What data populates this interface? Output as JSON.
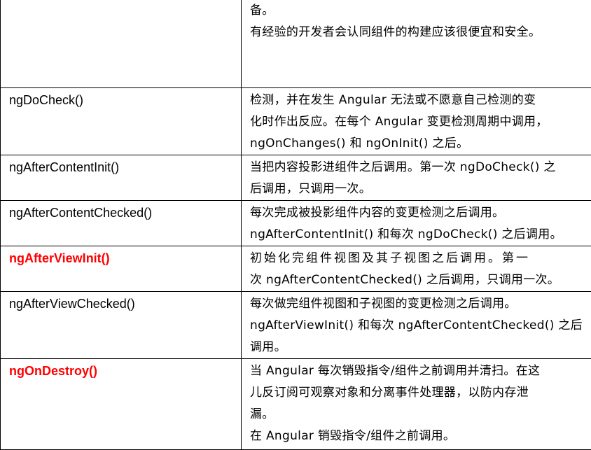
{
  "rows": [
    {
      "hook": "",
      "lines": [
        "备。",
        "有经验的开发者会认同组件的构建应该很便宜和安全。"
      ]
    },
    {
      "hook": "ngDoCheck()",
      "lines": [
        "检测，并在发生 Angular 无法或不愿意自己检测的变",
        "化时作出反应。在每个 Angular 变更检测周期中调用，",
        "ngOnChanges() 和 ngOnInit() 之后。"
      ]
    },
    {
      "hook": "ngAfterContentInit()",
      "lines": [
        "当把内容投影进组件之后调用。第一次 ngDoCheck() 之",
        "后调用，只调用一次。"
      ]
    },
    {
      "hook": "ngAfterContentChecked()",
      "lines": [
        "每次完成被投影组件内容的变更检测之后调用。",
        "ngAfterContentInit() 和每次 ngDoCheck() 之后调用。"
      ]
    },
    {
      "hook": "ngAfterViewInit()",
      "lines": [
        "初始化完组件视图及其子视图之后调用。第一",
        "次 ngAfterContentChecked() 之后调用，只调用一次。"
      ]
    },
    {
      "hook": "ngAfterViewChecked()",
      "lines": [
        "每次做完组件视图和子视图的变更检测之后调用。",
        "ngAfterViewInit() 和每次 ngAfterContentChecked() 之后",
        "调用。"
      ]
    },
    {
      "hook": "ngOnDestroy()",
      "lines": [
        "当 Angular 每次销毁指令/组件之前调用并清扫。在这",
        "儿反订阅可观察对象和分离事件处理器，以防内存泄",
        "漏。",
        "在 Angular 销毁指令/组件之前调用。"
      ]
    }
  ],
  "highlight_color": "#ff0000"
}
